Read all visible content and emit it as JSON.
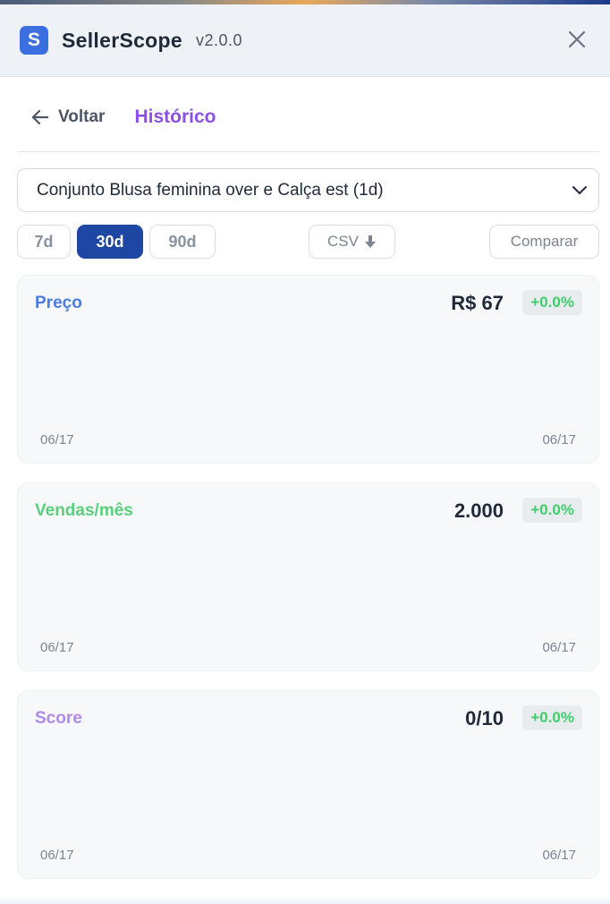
{
  "header": {
    "logo_letter": "S",
    "app_name": "SellerScope",
    "version": "v2.0.0",
    "close_icon": "close-icon",
    "accent_color": "#3b6fe0"
  },
  "nav": {
    "back_label": "Voltar",
    "title": "Histórico",
    "title_color": "#8b50e6"
  },
  "product_select": {
    "value": "Conjunto Blusa feminina over e Calça est (1d)"
  },
  "periods": [
    {
      "label": "7d",
      "active": false
    },
    {
      "label": "30d",
      "active": true
    },
    {
      "label": "90d",
      "active": false
    }
  ],
  "actions": {
    "csv_label": "CSV",
    "csv_icon": "download-arrow-icon",
    "compare_label": "Comparar"
  },
  "cards": [
    {
      "title": "Preço",
      "title_color": "#4a7ede",
      "value": "R$ 67",
      "change": "+0.0%",
      "x_start": "06/17",
      "x_end": "06/17"
    },
    {
      "title": "Vendas/mês",
      "title_color": "#5ad07d",
      "value": "2.000",
      "change": "+0.0%",
      "x_start": "06/17",
      "x_end": "06/17"
    },
    {
      "title": "Score",
      "title_color": "#b08be8",
      "value": "0/10",
      "change": "+0.0%",
      "x_start": "06/17",
      "x_end": "06/17"
    }
  ],
  "change_color": "#3fcf6a"
}
